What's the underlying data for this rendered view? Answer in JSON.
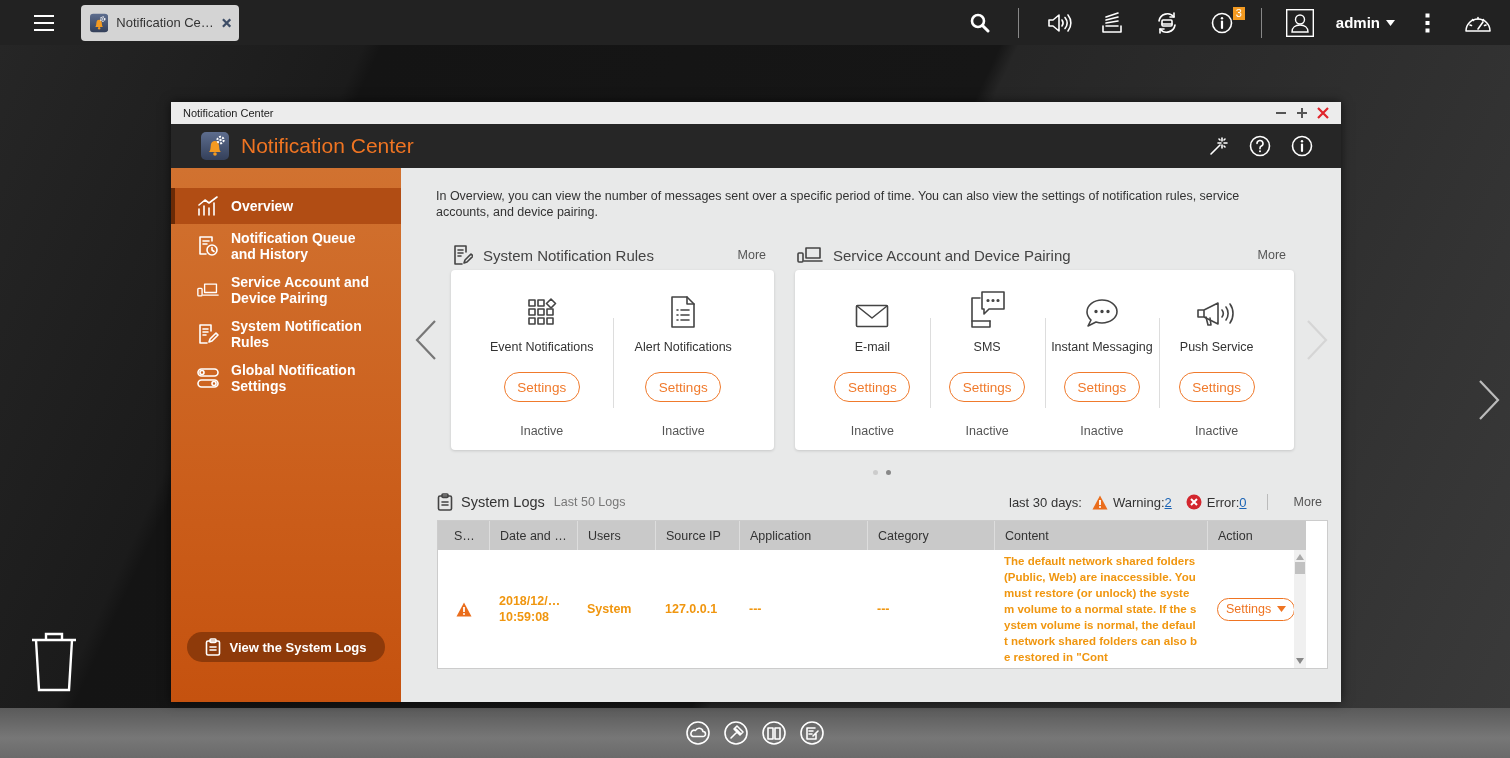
{
  "topbar": {
    "tab": {
      "title": "Notification Ce…"
    },
    "notification_count": "3",
    "user": "admin"
  },
  "window": {
    "title": "Notification Center",
    "app_title": "Notification Center"
  },
  "sidebar": {
    "items": [
      {
        "label": "Overview",
        "selected": true
      },
      {
        "label": "Notification Queue and History",
        "selected": false
      },
      {
        "label": "Service Account and Device Pairing",
        "selected": false
      },
      {
        "label": "System Notification Rules",
        "selected": false
      },
      {
        "label": "Global Notification Settings",
        "selected": false
      }
    ],
    "button": "View the System Logs"
  },
  "intro": "In Overview, you can view the number of messages sent over a specific period of time. You can also view the settings of notification rules, service accounts, and device pairing.",
  "sections": [
    {
      "title": "System Notification Rules",
      "more": "More",
      "items": [
        {
          "label": "Event Notifications",
          "button": "Settings",
          "status": "Inactive"
        },
        {
          "label": "Alert Notifications",
          "button": "Settings",
          "status": "Inactive"
        }
      ]
    },
    {
      "title": "Service Account and Device Pairing",
      "more": "More",
      "items": [
        {
          "label": "E-mail",
          "button": "Settings",
          "status": "Inactive"
        },
        {
          "label": "SMS",
          "button": "Settings",
          "status": "Inactive"
        },
        {
          "label": "Instant Messaging",
          "button": "Settings",
          "status": "Inactive"
        },
        {
          "label": "Push Service",
          "button": "Settings",
          "status": "Inactive"
        }
      ]
    }
  ],
  "carousel_dots": [
    {
      "selected": false
    },
    {
      "selected": true
    }
  ],
  "system_logs": {
    "title": "System Logs",
    "subtitle": "Last 50 Logs",
    "period": "last 30 days:",
    "warning_label": "Warning:",
    "warning_count": "2",
    "error_label": "Error:",
    "error_count": "0",
    "more": "More",
    "columns": [
      "S…",
      "Date and …",
      "Users",
      "Source IP",
      "Application",
      "Category",
      "Content",
      "Action"
    ],
    "rows": [
      {
        "kind": "warning",
        "date": "2018/12/…",
        "time": "10:59:08",
        "user": "System",
        "source_ip": "127.0.0.1",
        "application": "---",
        "category": "---",
        "content": "The default network shared folders (Public, Web) are inaccessible. You must restore (or unlock) the system volume to a normal state. If the system volume is normal, the default network shared folders can also be restored in \"Cont",
        "action": "Settings"
      }
    ]
  }
}
